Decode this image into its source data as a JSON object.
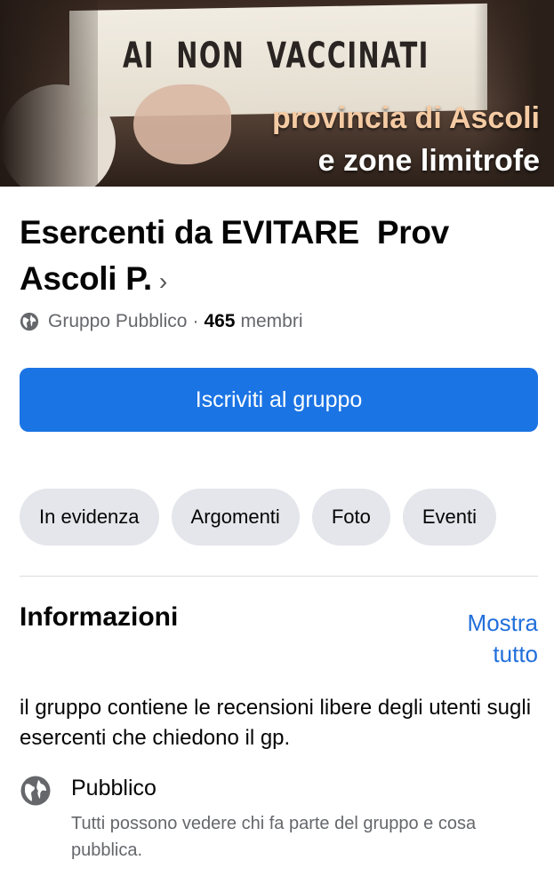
{
  "cover": {
    "banner_text": "AI NON VACCINATI",
    "line1": "provincia di Ascoli",
    "line2": "e zone limitrofe"
  },
  "group": {
    "title": "Esercenti da EVITARE  Prov Ascoli P.",
    "privacy": "Gruppo Pubblico",
    "separator": "·",
    "member_count": "465",
    "members_label": "membri"
  },
  "join_button": "Iscriviti al gruppo",
  "tabs": [
    "In evidenza",
    "Argomenti",
    "Foto",
    "Eventi"
  ],
  "info": {
    "heading": "Informazioni",
    "show_all": "Mostra tutto",
    "description": "il gruppo contiene  le recensioni libere degli utenti sugli esercenti che chiedono il gp.",
    "privacy_title": "Pubblico",
    "privacy_desc": "Tutti possono vedere chi fa parte del gruppo e cosa pubblica."
  },
  "colors": {
    "accent": "#1b74e4",
    "link": "#216fdb",
    "chip_bg": "#e4e6eb",
    "secondary_text": "#65676b"
  }
}
